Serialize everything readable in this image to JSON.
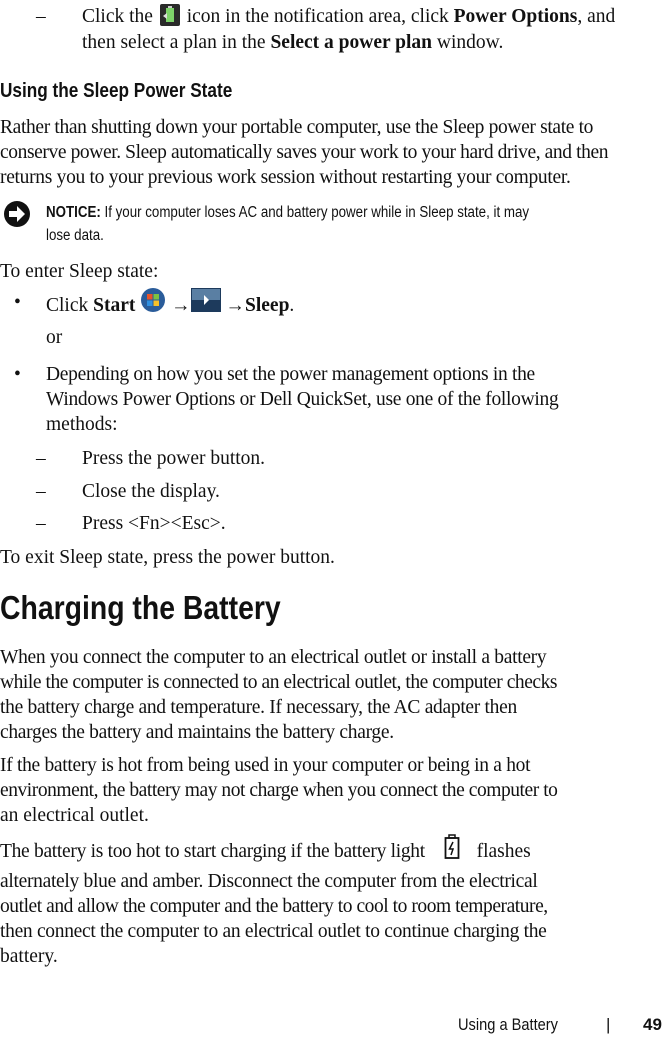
{
  "intro_step": {
    "part1": "Click the",
    "icon": "battery-power-meter-icon",
    "part2": "icon in the notification area, click",
    "bold1": "Power Options",
    "part3": ", and",
    "line2a": "then select a plan in the",
    "bold2": "Select a power plan",
    "line2b": "window."
  },
  "sleep_section": {
    "heading": "Using the Sleep Power State",
    "paragraph_lines": [
      "Rather than shutting down your portable computer, use the Sleep power state to",
      "conserve power. Sleep automatically saves your work to your hard drive, and then",
      "returns you to your previous work session without restarting your computer."
    ],
    "notice": {
      "icon": "notice-arrow-icon",
      "label": "NOTICE:",
      "line1": "If your computer loses AC and battery power while in Sleep state, it may",
      "line2": "lose data."
    },
    "enter_intro": "To enter Sleep state:",
    "bullet1": {
      "click": "Click",
      "start": "Start",
      "arrow": "→",
      "sleep": "Sleep",
      "period": "."
    },
    "or": "or",
    "bullet2_lines": [
      "Depending on how you set the power management options in the",
      "Windows Power Options or Dell QuickSet, use one of the following",
      "methods:"
    ],
    "methods": [
      "Press the power button.",
      "Close the display.",
      "Press <Fn><Esc>."
    ],
    "exit": "To exit Sleep state, press the power button."
  },
  "charging_section": {
    "heading": "Charging the Battery",
    "para1_lines": [
      "When you connect the computer to an electrical outlet or install a battery",
      "while the computer is connected to an electrical outlet, the computer checks",
      "the battery charge and temperature. If necessary, the AC adapter then",
      "charges the battery and maintains the battery charge."
    ],
    "para2_lines": [
      "If the battery is hot from being used in your computer or being in a hot",
      "environment, the battery may not charge when you connect the computer to",
      "an electrical outlet."
    ],
    "para3_line1a": "The battery is too hot to start charging if the battery light",
    "para3_line1b": "flashes",
    "para3_lines": [
      "alternately blue and amber. Disconnect the computer from the electrical",
      "outlet and allow the computer and the battery to cool to room temperature,",
      "then connect the computer to an electrical outlet to continue charging the",
      "battery."
    ]
  },
  "footer": {
    "section": "Using a Battery",
    "separator": "|",
    "page_number": "49"
  }
}
